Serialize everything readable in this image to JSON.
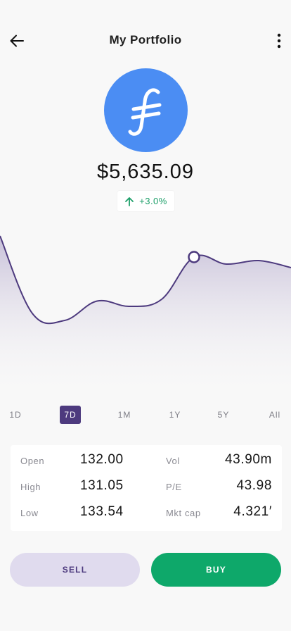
{
  "header": {
    "title": "My Portfolio",
    "back_icon": "arrow-left-icon",
    "menu_icon": "more-vertical-icon"
  },
  "asset": {
    "logo_icon": "filecoin-icon",
    "logo_color": "#4b8df3",
    "price": "$5,635.09",
    "change": "+3.0%",
    "change_icon": "arrow-up-icon",
    "change_color": "#1b9e68"
  },
  "chart_data": {
    "type": "area",
    "line_color": "#4d3a7e",
    "series": [
      {
        "values": [
          100,
          56,
          52,
          63,
          60,
          64,
          88,
          84,
          86,
          82
        ]
      }
    ],
    "highlight_index": 6,
    "grid": false,
    "legend": "none"
  },
  "ranges": {
    "items": [
      "1D",
      "7D",
      "1M",
      "1Y",
      "5Y",
      "All"
    ],
    "active": "7D",
    "active_color": "#4d3a7e"
  },
  "stats": {
    "open_label": "Open",
    "open_value": "132.00",
    "high_label": "High",
    "high_value": "131.05",
    "low_label": "Low",
    "low_value": "133.54",
    "vol_label": "Vol",
    "vol_value": "43.90m",
    "pe_label": "P/E",
    "pe_value": "43.98",
    "mktcap_label": "Mkt cap",
    "mktcap_value": "4.321′"
  },
  "actions": {
    "sell_label": "SELL",
    "buy_label": "BUY",
    "sell_color": "#e0dbee",
    "buy_color": "#0ea86a"
  }
}
